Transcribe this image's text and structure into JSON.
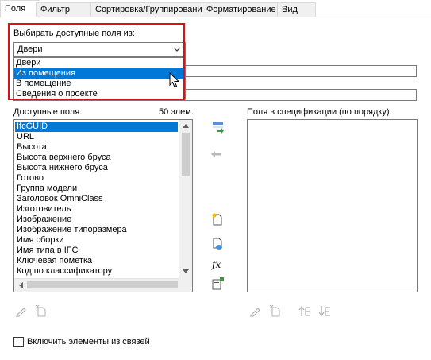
{
  "tabs": [
    "Поля",
    "Фильтр",
    "Сортировка/Группирование",
    "Форматирование",
    "Вид"
  ],
  "select_from": {
    "label": "Выбирать доступные поля из:",
    "value": "Двери",
    "options": [
      "Двери",
      "Из помещения",
      "В помещение",
      "Сведения о проекте"
    ],
    "highlighted_index": 1
  },
  "available": {
    "label": "Доступные поля:",
    "count": "50 элем.",
    "items": [
      "IfcGUID",
      "URL",
      "Высота",
      "Высота верхнего бруса",
      "Высота нижнего бруса",
      "Готово",
      "Группа модели",
      "Заголовок OmniClass",
      "Изготовитель",
      "Изображение",
      "Изображение типоразмера",
      "Имя сборки",
      "Имя типа в IFC",
      "Ключевая пометка",
      "Код по классификатору"
    ],
    "selected_index": 0
  },
  "schedule_fields": {
    "label": "Поля в спецификации (по порядку):"
  },
  "include_links": {
    "label": "Включить элементы из связей",
    "checked": false
  },
  "colors": {
    "selection": "#0078d7",
    "highlight_border": "#d9121a"
  }
}
